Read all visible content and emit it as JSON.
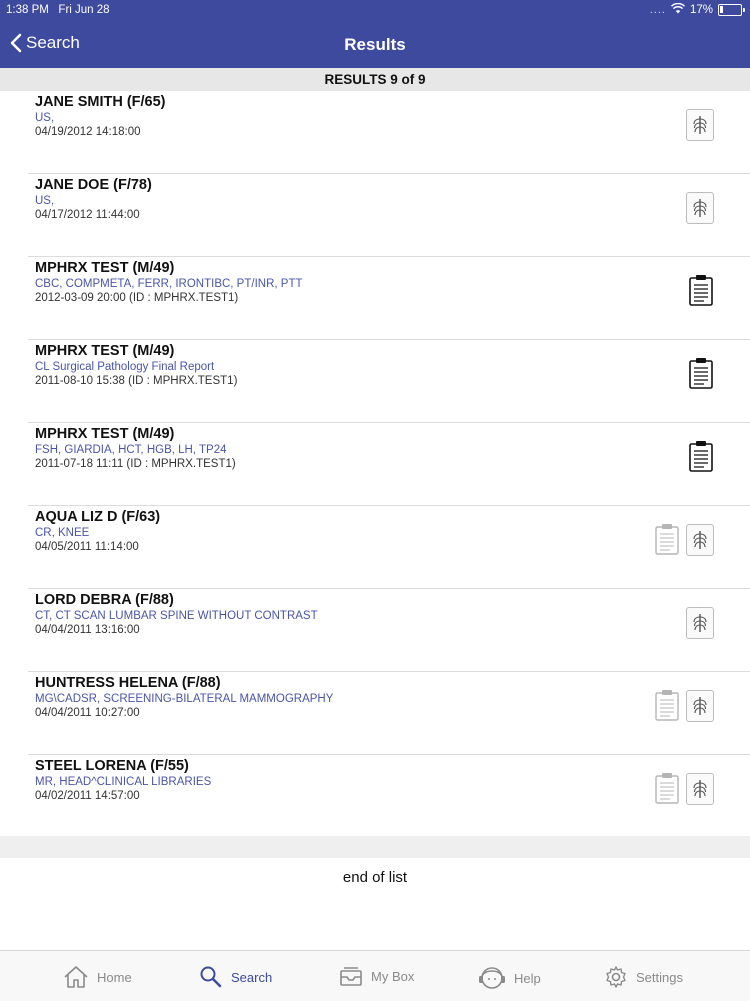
{
  "status_bar": {
    "time": "1:38 PM",
    "date": "Fri Jun 28",
    "battery": "17%",
    "battery_level": 0.17
  },
  "nav": {
    "back_label": "Search",
    "title": "Results"
  },
  "results_header": "RESULTS 9 of 9",
  "results": [
    {
      "name": "JANE SMITH (F/65)",
      "description": "US,",
      "date": "04/19/2012 14:18:00",
      "icons": [
        "xray-icon"
      ]
    },
    {
      "name": "JANE DOE (F/78)",
      "description": "US,",
      "date": "04/17/2012 11:44:00",
      "icons": [
        "xray-icon"
      ]
    },
    {
      "name": "MPHRX TEST (M/49)",
      "description": "CBC, COMPMETA, FERR, IRONTIBC, PT/INR, PTT",
      "date": "2012-03-09 20:00 (ID : MPHRX.TEST1)",
      "icons": [
        "report-icon"
      ]
    },
    {
      "name": "MPHRX TEST (M/49)",
      "description": "CL Surgical Pathology Final Report",
      "date": "2011-08-10 15:38 (ID : MPHRX.TEST1)",
      "icons": [
        "report-icon"
      ]
    },
    {
      "name": "MPHRX TEST (M/49)",
      "description": "FSH, GIARDIA, HCT, HGB, LH, TP24",
      "date": "2011-07-18 11:11 (ID : MPHRX.TEST1)",
      "icons": [
        "report-icon"
      ]
    },
    {
      "name": "AQUA LIZ D (F/63)",
      "description": "CR, KNEE",
      "date": "04/05/2011 11:14:00",
      "icons": [
        "report-light-icon",
        "xray-icon"
      ]
    },
    {
      "name": "LORD DEBRA (F/88)",
      "description": "CT, CT SCAN LUMBAR SPINE WITHOUT CONTRAST",
      "date": "04/04/2011 13:16:00",
      "icons": [
        "xray-icon"
      ]
    },
    {
      "name": "HUNTRESS HELENA (F/88)",
      "description": "MG\\CADSR, SCREENING-BILATERAL MAMMOGRAPHY",
      "date": "04/04/2011 10:27:00",
      "icons": [
        "report-light-icon",
        "xray-icon"
      ]
    },
    {
      "name": "STEEL LORENA (F/55)",
      "description": "MR, HEAD^CLINICAL LIBRARIES",
      "date": "04/02/2011 14:57:00",
      "icons": [
        "report-light-icon",
        "xray-icon"
      ]
    }
  ],
  "end_of_list": "end of list",
  "tabs": [
    {
      "label": "Home",
      "icon": "home-icon",
      "active": false
    },
    {
      "label": "Search",
      "icon": "search-icon",
      "active": true
    },
    {
      "label": "My Box",
      "icon": "inbox-icon",
      "active": false
    },
    {
      "label": "Help",
      "icon": "help-icon",
      "active": false
    },
    {
      "label": "Settings",
      "icon": "gear-icon",
      "active": false
    }
  ],
  "colors": {
    "header": "#3d4a9e",
    "link": "#4a55a8"
  }
}
